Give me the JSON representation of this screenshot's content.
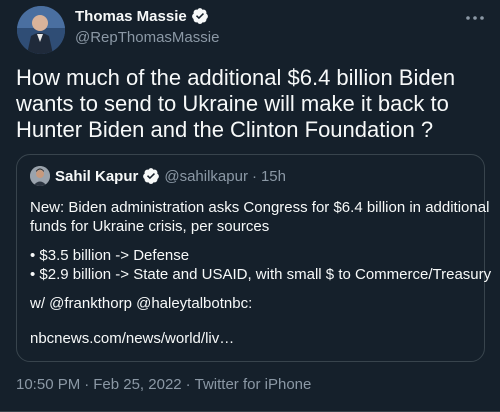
{
  "tweet": {
    "author_name": "Thomas Massie",
    "author_handle": "@RepThomasMassie",
    "text_line1": "How much of the additional $6.4 billion Biden",
    "text_line2": "wants to send to Ukraine will make it back to",
    "text_line3": "Hunter Biden and the Clinton Foundation ?",
    "time": "10:50 PM",
    "separator": "·",
    "date": "Feb 25, 2022",
    "client": "Twitter for iPhone"
  },
  "quote": {
    "author_name": "Sahil Kapur",
    "author_handle": "@sahilkapur",
    "separator": "·",
    "time": "15h",
    "line1": "New: Biden administration asks Congress for $6.4 billion in additional",
    "line2": "funds for Ukraine crisis, per sources",
    "line3": "• $3.5 billion -> Defense",
    "line4": "• $2.9 billion -> State and USAID, with small $ to Commerce/Treasury",
    "line5": "w/ @frankthorp @haleytalbotnbc:",
    "line6": "nbcnews.com/news/world/liv…"
  },
  "colors": {
    "background": "#15202b",
    "text": "#f7f9f9",
    "secondary": "#8b98a5",
    "verified": "#1d9bf0",
    "border": "#38444d"
  },
  "icons": {
    "verified": "verified-badge-icon",
    "more": "more-options-icon"
  }
}
